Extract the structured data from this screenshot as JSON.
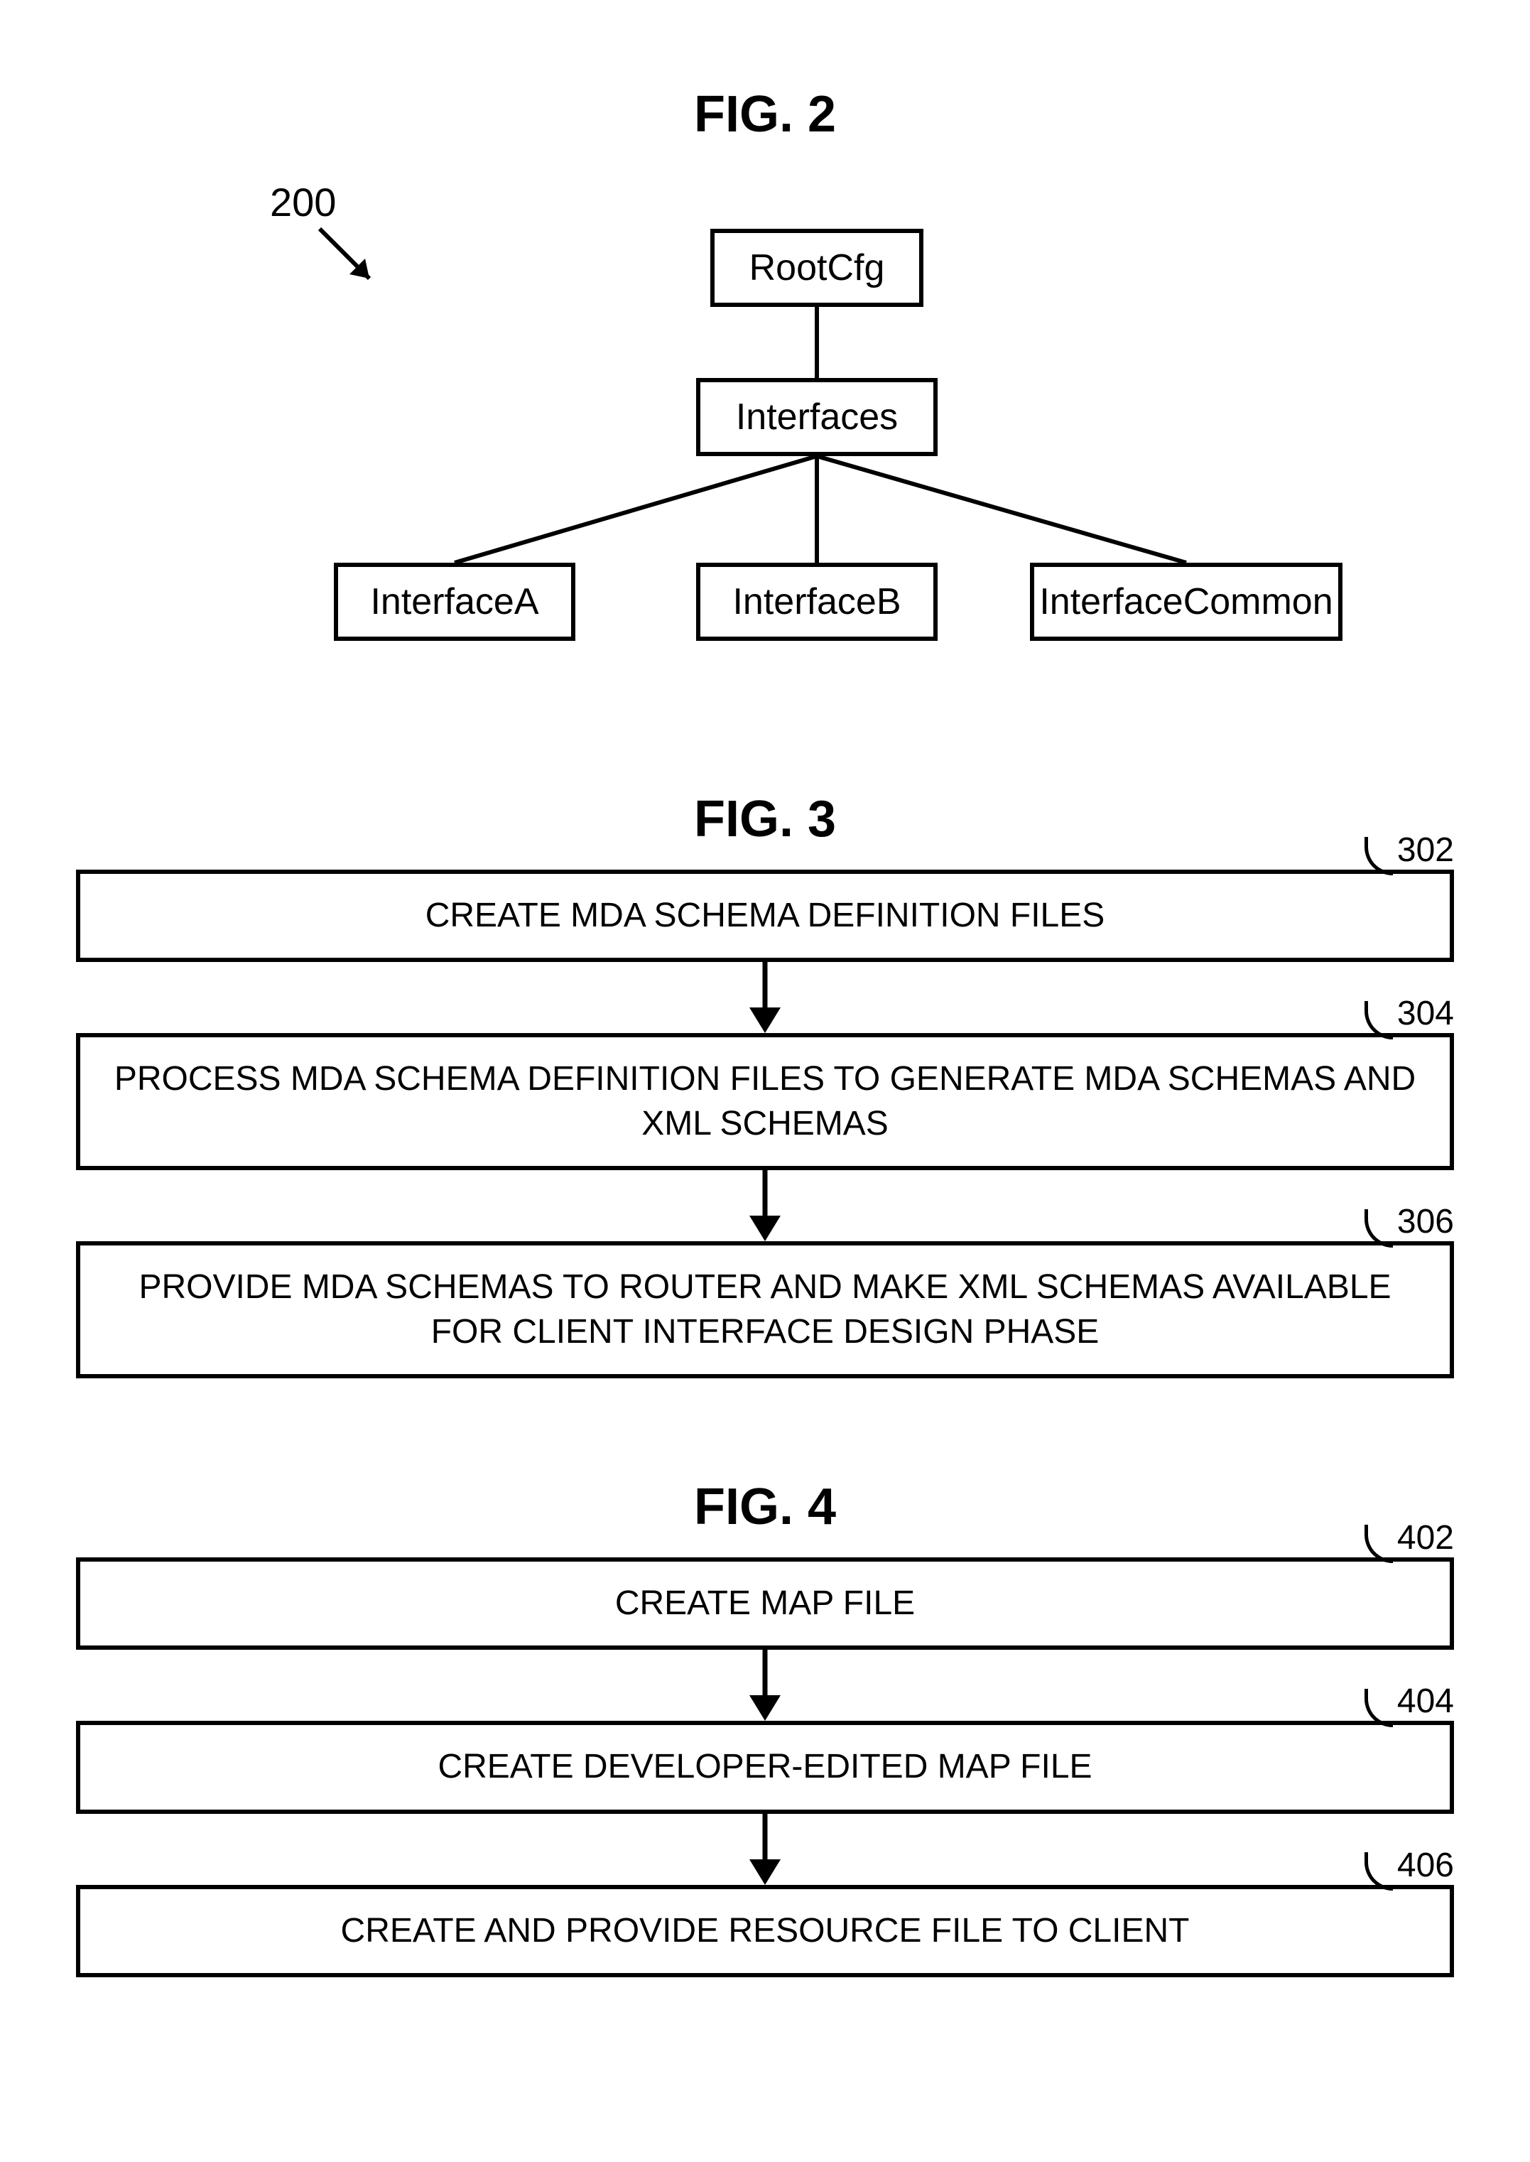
{
  "fig2": {
    "title": "FIG. 2",
    "ref": "200",
    "nodes": {
      "root": "RootCfg",
      "interfaces": "Interfaces",
      "a": "InterfaceA",
      "b": "InterfaceB",
      "common": "InterfaceCommon"
    }
  },
  "fig3": {
    "title": "FIG. 3",
    "steps": [
      {
        "ref": "302",
        "text": "CREATE MDA SCHEMA DEFINITION FILES"
      },
      {
        "ref": "304",
        "text": "PROCESS MDA SCHEMA DEFINITION FILES TO GENERATE MDA SCHEMAS AND XML SCHEMAS"
      },
      {
        "ref": "306",
        "text": "PROVIDE MDA SCHEMAS TO ROUTER AND MAKE XML SCHEMAS AVAILABLE FOR CLIENT INTERFACE DESIGN PHASE"
      }
    ]
  },
  "fig4": {
    "title": "FIG. 4",
    "steps": [
      {
        "ref": "402",
        "text": "CREATE MAP FILE"
      },
      {
        "ref": "404",
        "text": "CREATE DEVELOPER-EDITED MAP FILE"
      },
      {
        "ref": "406",
        "text": "CREATE AND PROVIDE RESOURCE FILE TO CLIENT"
      }
    ]
  }
}
